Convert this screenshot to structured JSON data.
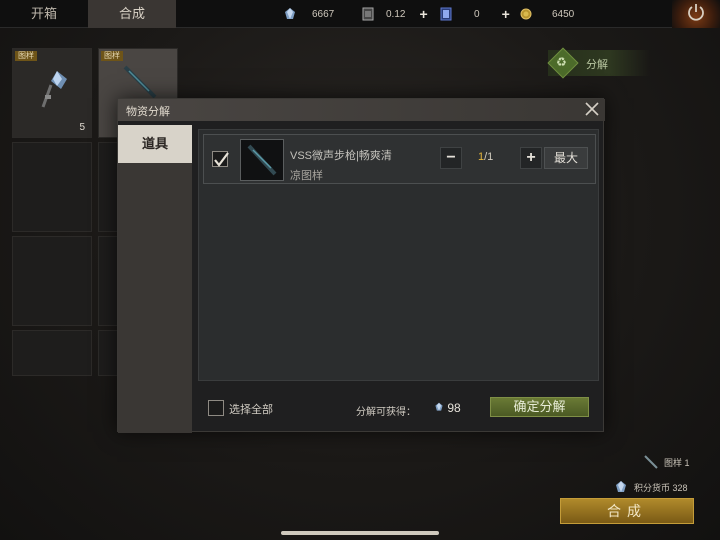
{
  "tabs": [
    {
      "label": "开箱",
      "active": false
    },
    {
      "label": "合成",
      "active": true
    }
  ],
  "resources": {
    "crystal": "6667",
    "card": "0.12",
    "ticket": "0",
    "coin": "6450"
  },
  "inventory": {
    "item1": {
      "tag": "图样",
      "count": "5",
      "icon": "crystal-icon"
    },
    "item2": {
      "tag": "图样",
      "icon": "rifle-icon"
    }
  },
  "decompose_button": {
    "label": "分解",
    "icon": "recycle-icon"
  },
  "modal": {
    "title": "物资分解",
    "side_tab": "道具",
    "item": {
      "name": "VSS微声步枪|畅爽清",
      "subtitle": "凉图样",
      "qty_current": "1",
      "qty_total": "/1",
      "minus": "−",
      "plus": "+",
      "max": "最大",
      "checked": true
    },
    "select_all": "选择全部",
    "gain_label": "分解可获得：",
    "gain_value": "98",
    "confirm": "确定分解"
  },
  "right_info": {
    "pattern_label": "图样 1",
    "points_label": "积分货币 328"
  },
  "craft_button": "合成",
  "colors": {
    "accent_gold": "#b08a2b",
    "confirm_green": "#5a6a2c",
    "qty_highlight": "#e6b73c"
  }
}
